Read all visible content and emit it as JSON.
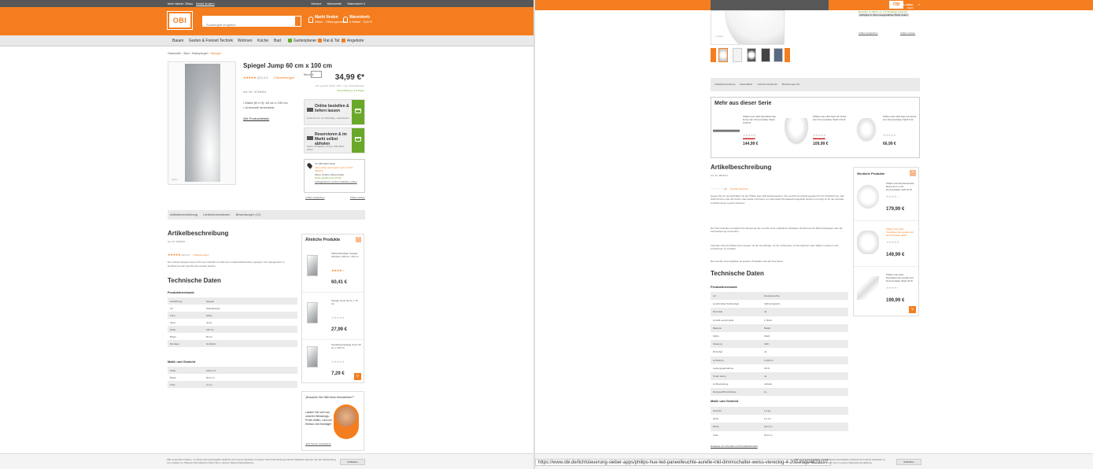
{
  "left": {
    "topbar": {
      "market": "Mein Markt: Zittau",
      "market_link": "Markt ändern",
      "links": [
        "Service",
        "Merkzettel",
        "Warenkorb 0"
      ]
    },
    "header": {
      "logo": "OBI",
      "search_placeholder": "Suchbegriff eingeben",
      "market_title": "Markt finden",
      "market_sub": "Zittau · Öffnungszeiten",
      "cart_title": "Warenkorb",
      "cart_sub": "0 Artikel · 0,00 €"
    },
    "nav": [
      "Bauen",
      "Garten & Freizeit",
      "Technik",
      "Wohnen",
      "Küche",
      "Bad",
      "Gartenplaner",
      "Rat & Tat",
      "Angebote"
    ],
    "breadcrumb": {
      "path": "Startseite › Bad › Badspiegel ›",
      "current": "Spiegel"
    },
    "product": {
      "title": "Spiegel Jump 60 cm x 100 cm",
      "stars": "★★★★★",
      "rating_count": "(12) 4,3",
      "rating_link": "3 Bewertungen",
      "note": "Art.-Nr. 3748424",
      "bullets": [
        "Maße (B x H): 60 cm x 100 cm",
        "Universell einsetzbar"
      ],
      "details_link": "Alle Produktdetails",
      "image_zoom": "Zoom"
    },
    "buybox": {
      "qty_label": "Menge",
      "qty_value": "1",
      "price": "34,99 €*",
      "price_sub": "inkl. gesetzl. MwSt. 19% · zzgl. Versandkosten",
      "availability": "Versandfertig in 4-5 Tagen",
      "option1_title": "Online bestellen & liefern lassen",
      "option1_sub": "Lieferzeit ca. 2-4 Werktage, Lieferkosten",
      "option2_title": "Reservieren & im Markt selbst abholen",
      "option2_sub": "Sofort verfügbar in Ihrem OBI Markt Zittau",
      "store_name": "Ihr OBI Markt Zittau",
      "store_warn": "Jetzt online reservieren und in 2 Std. abholen",
      "store_addr": "Zittau, Äußere Weberstraße",
      "store_hours": "Heute geöffnet bis 20 Uhr",
      "store_link": "Verfügbarkeit in anderen Märkten prüfen",
      "footer_left": "Artikel vergleichen",
      "footer_right": "Artikel merken"
    },
    "tabs": [
      "Artikelbeschreibung",
      "Lieferinformationen",
      "Bewertungen (12)"
    ],
    "description": {
      "title": "Artikelbeschreibung",
      "sub": "Art.-Nr. 3748424",
      "stars": "★★★★★",
      "rating": "(12) 4,3",
      "rating_link": "3 Bewertungen",
      "text": "Der zeitlose Spiegel Jump ist für eine Vielzahl von Räumen und Einsatzbereichen geeignet. Der Spiegel kann in Hochformat oder Querformat montiert werden."
    },
    "tech": {
      "title": "Technische Daten",
      "group1": "Produktmerkmale",
      "rows1": [
        [
          "Ausführung",
          "Spiegel"
        ],
        [
          "Art",
          "Standspiegel"
        ],
        [
          "Form",
          "Eckig"
        ],
        [
          "Serie",
          "Jump"
        ],
        [
          "Höhe",
          "100 cm"
        ],
        [
          "Breite",
          "60 cm"
        ],
        [
          "Montage",
          "Hochkant"
        ]
      ],
      "group2": "Maße und Gewicht",
      "rows2": [
        [
          "Höhe",
          "100,0 cm"
        ],
        [
          "Breite",
          "60,0 cm"
        ],
        [
          "Tiefe",
          "0 mm"
        ]
      ]
    },
    "similar": {
      "title": "Ähnliche Produkte",
      "items": [
        {
          "name": "Flächenbündiger Spiegel, Scheiben 100 cm x 60 cm",
          "price": "60,41 €",
          "stars": "★★★★☆"
        },
        {
          "name": "Spiegel Jump 50 cm x 70 cm",
          "price": "27,99 €",
          "stars": "★★★★★"
        },
        {
          "name": "Ganzkörperspiegel Jump 30 cm x 120 cm",
          "price": "7,29 €",
          "stars": "★★★★★"
        }
      ]
    },
    "advice": {
      "question": "„Brauchen Sie Hilfe beim Heimwerken?“",
      "text": "Lassen Sie sich von unseren Beratungs-Profis helfen, rund um Einbau und Montage!",
      "link": "Jetzt Termin vereinbaren"
    },
    "cookie": {
      "text": "OBI verwendet Cookies, um Ihnen das bestmögliche Erlebnis auf unserer Webseite zu bieten. Durch die Nutzung unserer Webseite stimmen Sie der Verwendung von Cookies zu. Weitere Informationen finden Sie in unserer Datenschutzerklärung.",
      "button": "Schließen"
    }
  },
  "right": {
    "topbar": {
      "market": "Mein Markt: Zittau",
      "market_link": "Markt ändern",
      "links": [
        "Service",
        "Merkzettel",
        "0"
      ]
    },
    "avail": {
      "line1": "Bestellen im Markt, ca. 4-5 Werktage Lieferzeit",
      "line2": "Verfügbar in Ihrem ausgewählten Markt prüfen",
      "link_left": "Artikel vergleichen",
      "link_right": "Artikel merken"
    },
    "tabs": [
      "Artikelbeschreibung",
      "Datenblätter",
      "Lieferinformationen",
      "Bewertungen (0)"
    ],
    "series": {
      "title": "Mehr aus dieser Serie",
      "items": [
        {
          "name": "Philips Hue LED-Pendelleuchte Ensis inkl. Dimmschalter Weiß 2x39 W",
          "old": "UVP 169,99 €",
          "price": "144,99 €"
        },
        {
          "name": "Philips Hue LED-Spot 3er Ensis inkl. Dimmschalter Weiß 2x5 W",
          "old": "UVP 129,99 €",
          "price": "109,99 €"
        },
        {
          "name": "Philips Hue LED-Spot 1er Ensis inkl. Dimmschalter Weiß 5 W",
          "old": "",
          "price": "66,99 €"
        }
      ]
    },
    "description": {
      "title": "Artikelbeschreibung",
      "sub": "Art.-Nr. 4823107",
      "stars": "☆☆☆☆☆",
      "rating": "(0)",
      "rating_link": "Produkt bewerten",
      "para1": "Sorgen Sie für Gemütlichkeit mit der Philips Hue LED-Deckenleuchte. Die Leuchte ist perfekt geeignet für Ihr Schlafzimmer, das Wohnzimmer oder die Küche. Das weiße Licht kann von warmweiß bis kaltweiß eingestellt werden und sorgt so für die optimale Lichtstimmung in jedem Moment.",
      "para2": "Der Dimmschalter ermöglicht die Steuerung der Leuchte ohne zusätzliche Hardware. Einfach an der Wand befestigen oder als Fernbedienung verwenden.",
      "para3": "Verbinden Sie die Philips Hue Lampen mit der Hue Bridge, um Ihr Lichtsystem mit Smartphone oder Tablet zu steuern und Lichtszenen zu erstellen.",
      "para4": "Die Leuchte ist kompatibel mit anderen Produkten aus der Hue-Serie."
    },
    "tech": {
      "title": "Technische Daten",
      "group1": "Produktmerkmale",
      "rows1": [
        [
          "Art",
          "Deckenleuchte"
        ],
        [
          "Leuchtmittel-Technologie",
          "LED (integriert)"
        ],
        [
          "Dimmbar",
          "Ja"
        ],
        [
          "Anzahl Leuchtmittel",
          "1 Stück"
        ],
        [
          "Material",
          "Metall"
        ],
        [
          "Farbe",
          "Weiß"
        ],
        [
          "Fassung",
          "LED"
        ],
        [
          "Dimmbar",
          "Ja"
        ],
        [
          "Lichtstrom",
          "2.400 lm"
        ],
        [
          "Leistungsaufnahme",
          "40 W"
        ],
        [
          "Smart Home",
          "Ja"
        ],
        [
          "Lichtverteilung",
          "Indirekt"
        ],
        [
          "Energieeffizienzklasse",
          "A+"
        ]
      ],
      "group2": "Maße und Gewicht",
      "rows2": [
        [
          "Gewicht",
          "1,4 kg"
        ],
        [
          "Höhe",
          "6,1 cm"
        ],
        [
          "Breite",
          "30,0 cm"
        ],
        [
          "Tiefe",
          "30,0 cm"
        ]
      ],
      "footlink": "Hinweise zum Produkt und Produktsicherheit"
    },
    "similar": {
      "title": "Ähnliche Produkte",
      "items": [
        {
          "name": "Philips Hue Deckenleuchte Being 32 cm inkl. Dimmschalter LED 22 W",
          "price": "179,99 €",
          "stars": "★★★★☆"
        },
        {
          "name": "Philips Hue LED-Pendelleuchte Aurelle inkl. Dimmschalter Weiß",
          "price": "149,99 €",
          "stars": "★★★★★"
        },
        {
          "name": "Philips Hue LED-Pendelleuchte Aurelle inkl. Dimmschalter Weiß 40 W",
          "price": "199,99 €",
          "stars": "★★★★☆"
        }
      ]
    },
    "url": "https://www.obi.de/lichtsteuerung-sieber-apps/philips-hue-led-paneelleuchte-aurelle-inkl-dimmschalter-weiss-viereckig-4-200-lm/p/4823107",
    "cookie": {
      "text": "OBI verwendet Cookies, um Ihnen das bestmögliche Erlebnis auf unserer Webseite zu bieten. Weitere Informationen finden Sie in unserer Datenschutzerklärung.",
      "button": "Schließen"
    }
  }
}
